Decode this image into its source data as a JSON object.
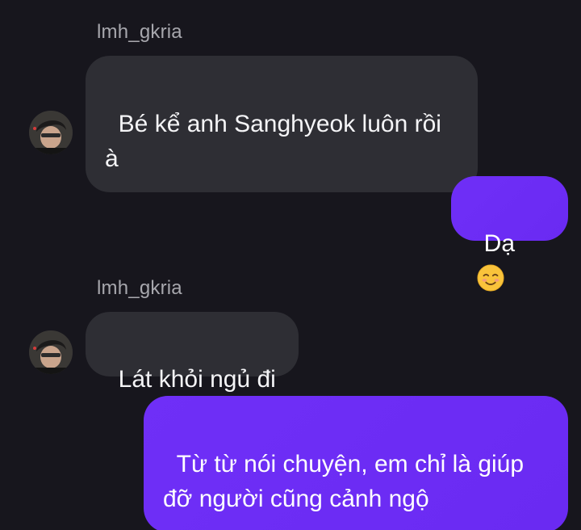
{
  "messages": [
    {
      "sender": "lmh_gkria",
      "text": "Bé kể anh Sanghyeok luôn rồi à",
      "direction": "incoming"
    },
    {
      "text": "Dạ",
      "emoji": "smiling-face-icon",
      "direction": "outgoing"
    },
    {
      "sender": "lmh_gkria",
      "text": "Lát khỏi ngủ đi",
      "direction": "incoming"
    },
    {
      "text": "Từ từ nói chuyện, em chỉ là giúp đỡ người cũng cảnh ngộ",
      "direction": "outgoing"
    }
  ],
  "colors": {
    "background": "#17161d",
    "incoming_bubble": "#2e2e34",
    "outgoing_bubble": "#6c2cf6",
    "sender_text": "#a7a7ad"
  }
}
